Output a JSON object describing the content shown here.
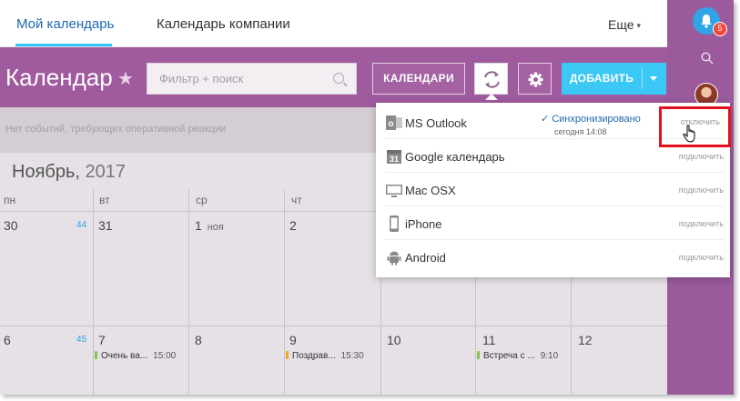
{
  "tabs": [
    {
      "label": "Мой календарь",
      "active": true
    },
    {
      "label": "Календарь компании",
      "active": false
    }
  ],
  "more_label": "Еще",
  "header": {
    "title": "Календарь",
    "search_placeholder": "Фильтр + поиск",
    "calendars_button": "КАЛЕНДАРИ",
    "add_button": "ДОБАВИТЬ"
  },
  "notice": "Нет событий, требующих оперативной реакции",
  "month_label": "Ноябрь,",
  "year_label": "2017",
  "weekdays": [
    "пн",
    "вт",
    "ср",
    "чт"
  ],
  "weeks": [
    {
      "week_number": "44",
      "days": [
        "30",
        "31",
        "1",
        "2"
      ],
      "day3_suffix": "ноя"
    },
    {
      "week_number": "45",
      "days": [
        "6",
        "7",
        "8",
        "9",
        "10",
        "11",
        "12"
      ]
    }
  ],
  "events": [
    {
      "title": "Очень ва...",
      "time": "15:00",
      "color": "#8bc34a"
    },
    {
      "title": "Поздрав...",
      "time": "15:30",
      "color": "#f5a623"
    },
    {
      "title": "Встреча с ...",
      "time": "9:10",
      "color": "#8bc34a"
    }
  ],
  "sync_menu": [
    {
      "name": "MS Outlook",
      "icon": "outlook-icon",
      "action": "отключить",
      "status": "Синхронизировано",
      "status_time": "сегодня 14:08"
    },
    {
      "name": "Google календарь",
      "icon": "google-calendar-icon",
      "action": "подключить"
    },
    {
      "name": "Mac OSX",
      "icon": "monitor-icon",
      "action": "подключить"
    },
    {
      "name": "iPhone",
      "icon": "iphone-icon",
      "action": "подключить"
    },
    {
      "name": "Android",
      "icon": "android-icon",
      "action": "подключить"
    }
  ],
  "notifications_count": "5",
  "colors": {
    "accent": "#3bc8f5",
    "header_purple": "#a05a9e",
    "sidebar_purple": "#9b5a9c",
    "highlight": "#e2111e",
    "link_blue": "#2067b0"
  }
}
